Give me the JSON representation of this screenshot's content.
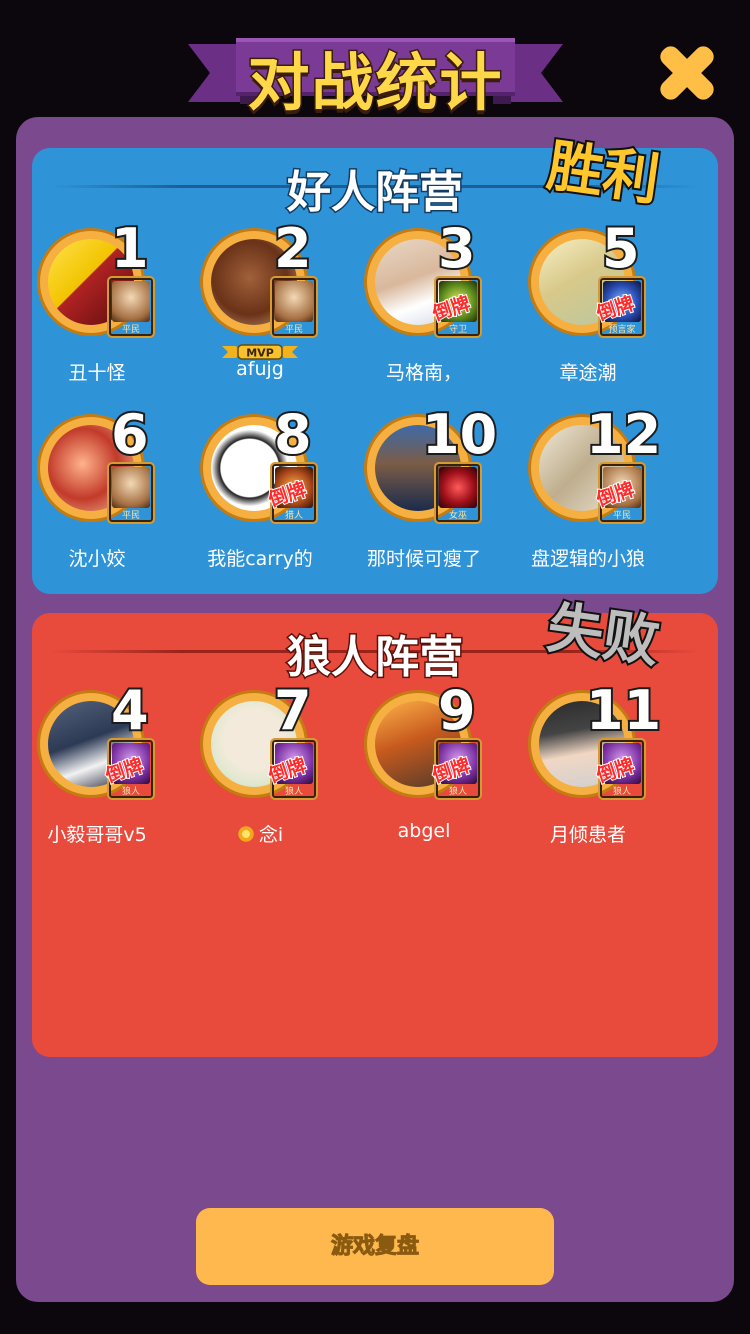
{
  "header": {
    "title": "对战统计",
    "close_icon": "close-x-icon"
  },
  "good_camp": {
    "title": "好人阵营",
    "result": "胜利",
    "players": [
      {
        "seat": "1",
        "name": "丑十怪",
        "role": "平民",
        "role_art": "villager",
        "flipped": false,
        "mvp": false
      },
      {
        "seat": "2",
        "name": "afujg",
        "role": "平民",
        "role_art": "villager",
        "flipped": false,
        "mvp": true
      },
      {
        "seat": "3",
        "name": "马格南，",
        "role": "守卫",
        "role_art": "guard",
        "flipped": true,
        "mvp": false
      },
      {
        "seat": "5",
        "name": "章途潮",
        "role": "预言家",
        "role_art": "seer",
        "flipped": true,
        "mvp": false
      },
      {
        "seat": "6",
        "name": "沈小姣",
        "role": "平民",
        "role_art": "villager",
        "flipped": false,
        "mvp": false
      },
      {
        "seat": "8",
        "name": "我能carry的",
        "role": "猎人",
        "role_art": "hunter",
        "flipped": true,
        "mvp": false
      },
      {
        "seat": "10",
        "name": "那时候可瘦了",
        "role": "女巫",
        "role_art": "witch",
        "flipped": false,
        "mvp": false
      },
      {
        "seat": "12",
        "name": "盘逻辑的小狼",
        "role": "平民",
        "role_art": "villager",
        "flipped": true,
        "mvp": false
      }
    ]
  },
  "bad_camp": {
    "title": "狼人阵营",
    "result": "失败",
    "players": [
      {
        "seat": "4",
        "name": "小毅哥哥v5",
        "role": "狼人",
        "role_art": "wolf",
        "flipped": true
      },
      {
        "seat": "7",
        "name": "念i",
        "role": "狼人",
        "role_art": "wolf",
        "flipped": true
      },
      {
        "seat": "9",
        "name": "abgel",
        "role": "狼人",
        "role_art": "wolf",
        "flipped": true
      },
      {
        "seat": "11",
        "name": "月倾患者",
        "role": "狼人",
        "role_art": "wolf",
        "flipped": true
      }
    ]
  },
  "labels": {
    "flip": "倒牌",
    "mvp": "MVP"
  },
  "replay_button": "游戏复盘",
  "colors": {
    "background": "#0b070d",
    "panel": "#7b4a8e",
    "good_camp": "#2f93d8",
    "bad_camp": "#e84a3c",
    "title_yellow": "#ffd84a",
    "button": "#ffb84d"
  }
}
